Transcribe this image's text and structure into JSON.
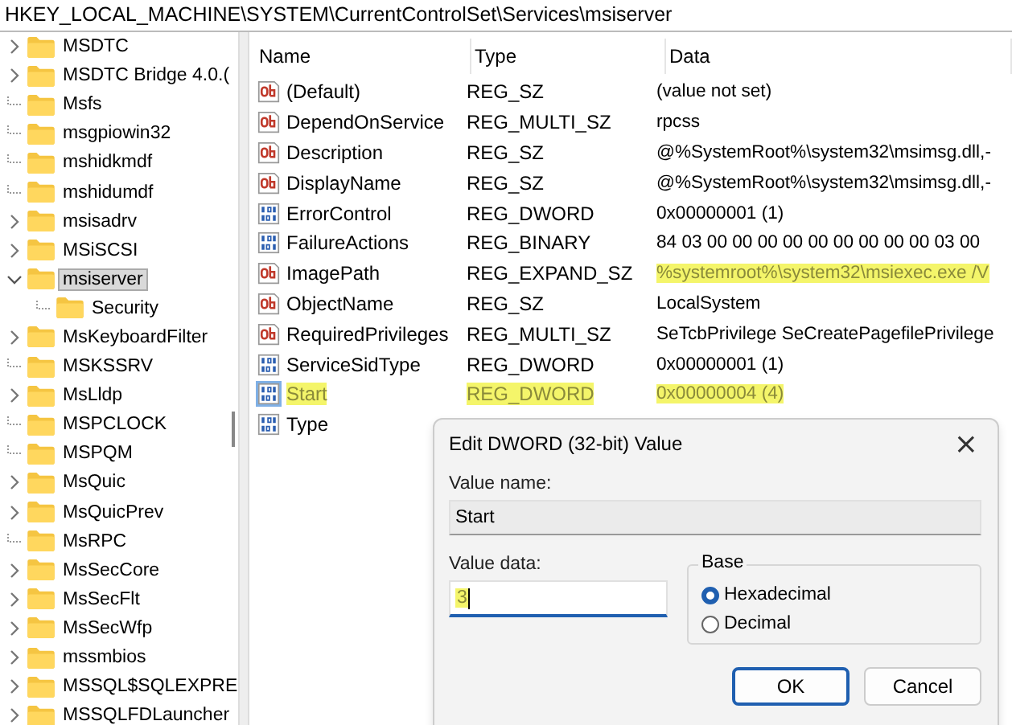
{
  "address_bar": {
    "path": "HKEY_LOCAL_MACHINE\\SYSTEM\\CurrentControlSet\\Services\\msiserver"
  },
  "tree": {
    "items": [
      {
        "label": "MSDTC",
        "kind": "collapsed",
        "selected": false
      },
      {
        "label": "MSDTC Bridge 4.0.(",
        "kind": "collapsed",
        "selected": false
      },
      {
        "label": "Msfs",
        "kind": "leaf",
        "selected": false
      },
      {
        "label": "msgpiowin32",
        "kind": "leaf",
        "selected": false
      },
      {
        "label": "mshidkmdf",
        "kind": "leaf",
        "selected": false
      },
      {
        "label": "mshidumdf",
        "kind": "leaf",
        "selected": false
      },
      {
        "label": "msisadrv",
        "kind": "collapsed",
        "selected": false
      },
      {
        "label": "MSiSCSI",
        "kind": "collapsed",
        "selected": false
      },
      {
        "label": "msiserver",
        "kind": "expanded",
        "selected": true,
        "children": [
          {
            "label": "Security",
            "kind": "leaf",
            "selected": false
          }
        ]
      },
      {
        "label": "MsKeyboardFilter",
        "kind": "collapsed",
        "selected": false
      },
      {
        "label": "MSKSSRV",
        "kind": "leaf",
        "selected": false
      },
      {
        "label": "MsLldp",
        "kind": "collapsed",
        "selected": false
      },
      {
        "label": "MSPCLOCK",
        "kind": "leaf",
        "selected": false
      },
      {
        "label": "MSPQM",
        "kind": "leaf",
        "selected": false
      },
      {
        "label": "MsQuic",
        "kind": "collapsed",
        "selected": false
      },
      {
        "label": "MsQuicPrev",
        "kind": "collapsed",
        "selected": false
      },
      {
        "label": "MsRPC",
        "kind": "leaf",
        "selected": false
      },
      {
        "label": "MsSecCore",
        "kind": "collapsed",
        "selected": false
      },
      {
        "label": "MsSecFlt",
        "kind": "collapsed",
        "selected": false
      },
      {
        "label": "MsSecWfp",
        "kind": "collapsed",
        "selected": false
      },
      {
        "label": "mssmbios",
        "kind": "collapsed",
        "selected": false
      },
      {
        "label": "MSSQL$SQLEXPRE",
        "kind": "collapsed",
        "selected": false
      },
      {
        "label": "MSSQLFDLauncher",
        "kind": "collapsed",
        "selected": false
      }
    ]
  },
  "table": {
    "columns": [
      "Name",
      "Type",
      "Data"
    ],
    "rows": [
      {
        "kind": "string",
        "name": "(Default)",
        "type": "REG_SZ",
        "data": "(value not set)",
        "selected": false,
        "highlight_name": false,
        "highlight_type": false,
        "highlight_data": false
      },
      {
        "kind": "string",
        "name": "DependOnService",
        "type": "REG_MULTI_SZ",
        "data": "rpcss",
        "selected": false,
        "highlight_name": false,
        "highlight_type": false,
        "highlight_data": false
      },
      {
        "kind": "string",
        "name": "Description",
        "type": "REG_SZ",
        "data": "@%SystemRoot%\\system32\\msimsg.dll,-",
        "selected": false,
        "highlight_name": false,
        "highlight_type": false,
        "highlight_data": false
      },
      {
        "kind": "string",
        "name": "DisplayName",
        "type": "REG_SZ",
        "data": "@%SystemRoot%\\system32\\msimsg.dll,-",
        "selected": false,
        "highlight_name": false,
        "highlight_type": false,
        "highlight_data": false
      },
      {
        "kind": "binary",
        "name": "ErrorControl",
        "type": "REG_DWORD",
        "data": "0x00000001 (1)",
        "selected": false,
        "highlight_name": false,
        "highlight_type": false,
        "highlight_data": false
      },
      {
        "kind": "binary",
        "name": "FailureActions",
        "type": "REG_BINARY",
        "data": "84 03 00 00 00 00 00 00 00 00 00 03 00",
        "selected": false,
        "highlight_name": false,
        "highlight_type": false,
        "highlight_data": false
      },
      {
        "kind": "string",
        "name": "ImagePath",
        "type": "REG_EXPAND_SZ",
        "data": "%systemroot%\\system32\\msiexec.exe /V",
        "selected": false,
        "highlight_name": false,
        "highlight_type": false,
        "highlight_data": true
      },
      {
        "kind": "string",
        "name": "ObjectName",
        "type": "REG_SZ",
        "data": "LocalSystem",
        "selected": false,
        "highlight_name": false,
        "highlight_type": false,
        "highlight_data": false
      },
      {
        "kind": "string",
        "name": "RequiredPrivileges",
        "type": "REG_MULTI_SZ",
        "data": "SeTcbPrivilege SeCreatePagefilePrivilege",
        "selected": false,
        "highlight_name": false,
        "highlight_type": false,
        "highlight_data": false
      },
      {
        "kind": "binary",
        "name": "ServiceSidType",
        "type": "REG_DWORD",
        "data": "0x00000001 (1)",
        "selected": false,
        "highlight_name": false,
        "highlight_type": false,
        "highlight_data": false
      },
      {
        "kind": "binary",
        "name": "Start",
        "type": "REG_DWORD",
        "data": "0x00000004 (4)",
        "selected": true,
        "highlight_name": true,
        "highlight_type": true,
        "highlight_data": true
      },
      {
        "kind": "binary",
        "name": "Type",
        "selected": false,
        "highlight_name": false
      }
    ]
  },
  "dialog": {
    "title": "Edit DWORD (32-bit) Value",
    "close": "×",
    "value_name": {
      "label": "Value name:",
      "value": "Start"
    },
    "value_data": {
      "label": "Value data:",
      "value": "3",
      "highlighted": true
    },
    "base": {
      "label": "Base",
      "options": [
        {
          "label": "Hexadecimal",
          "selected": true
        },
        {
          "label": "Decimal",
          "selected": false
        }
      ]
    },
    "buttons": [
      {
        "label": "OK",
        "default": true
      },
      {
        "label": "Cancel",
        "default": false
      }
    ]
  }
}
